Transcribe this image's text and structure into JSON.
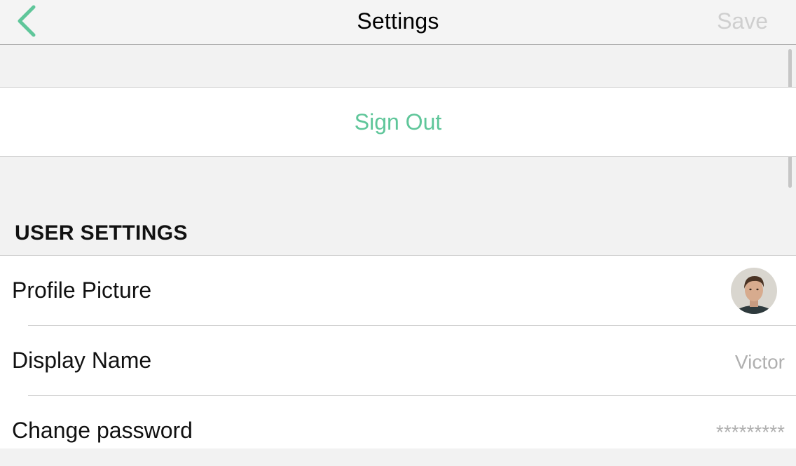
{
  "navbar": {
    "title": "Settings",
    "save_label": "Save"
  },
  "sign_out": {
    "label": "Sign Out"
  },
  "user_settings": {
    "header": "USER SETTINGS",
    "rows": [
      {
        "label": "Profile Picture",
        "value": ""
      },
      {
        "label": "Display Name",
        "value": "Victor"
      },
      {
        "label": "Change password",
        "value": "*********"
      }
    ]
  },
  "colors": {
    "accent": "#5fc69a",
    "disabled": "#cfcfcf",
    "secondary_text": "#b0b0b0",
    "background": "#f2f2f2"
  },
  "icons": {
    "back": "chevron-left-icon"
  }
}
